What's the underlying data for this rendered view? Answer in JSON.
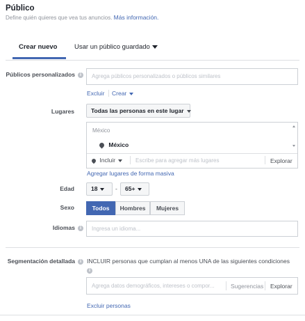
{
  "header": {
    "title": "Público",
    "subtitle": "Define quién quieres que vea tus anuncios.",
    "more_info": "Más información."
  },
  "tabs": [
    {
      "label": "Crear nuevo",
      "active": true
    },
    {
      "label": "Usar un público guardado",
      "active": false
    }
  ],
  "custom_audiences": {
    "label": "Públicos personalizados",
    "placeholder": "Agrega públicos personalizados o públicos similares",
    "exclude": "Excluir",
    "create": "Crear"
  },
  "locations": {
    "label": "Lugares",
    "type_select": "Todas las personas en este lugar",
    "country_header": "México",
    "selected": "México",
    "include_select": "Incluir",
    "placeholder": "Escribe para agregar más lugares",
    "browse": "Explorar",
    "bulk_link": "Agregar lugares de forma masiva"
  },
  "age": {
    "label": "Edad",
    "min": "18",
    "separator": "-",
    "max": "65+"
  },
  "gender": {
    "label": "Sexo",
    "options": [
      "Todos",
      "Hombres",
      "Mujeres"
    ],
    "selected": "Todos"
  },
  "languages": {
    "label": "Idiomas",
    "placeholder": "Ingresa un idioma..."
  },
  "detailed_targeting": {
    "label": "Segmentación detallada",
    "description": "INCLUIR personas que cumplan al menos UNA de las siguientes condiciones",
    "placeholder": "Agrega datos demográficos, intereses o compor...",
    "suggestions": "Sugerencias",
    "browse": "Explorar",
    "exclude_link": "Excluir personas"
  },
  "colors": {
    "accent": "#4267b2",
    "border": "#ccd0d5",
    "muted": "#90949c"
  }
}
